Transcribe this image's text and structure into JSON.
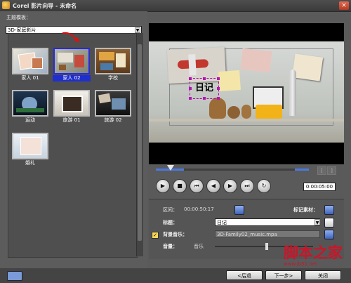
{
  "window": {
    "title": "Corel 影片向导 - 未命名"
  },
  "left_panel": {
    "theme_label": "主题模板：",
    "theme_select": "3D-家庭影片",
    "templates": [
      {
        "label": "家人 01",
        "selected": false
      },
      {
        "label": "家人 02",
        "selected": true
      },
      {
        "label": "学校",
        "selected": false
      },
      {
        "label": "运动",
        "selected": false
      },
      {
        "label": "旅游 01",
        "selected": false
      },
      {
        "label": "旅游 02",
        "selected": false
      },
      {
        "label": "婚礼",
        "selected": false
      }
    ]
  },
  "preview": {
    "overlay_text": "日记",
    "timecode": "0:00:05:00"
  },
  "transport": {
    "play": "▶",
    "stop": "■",
    "home": "⏮",
    "prev": "◀",
    "next": "▶",
    "end": "⏭",
    "repeat": "↻"
  },
  "properties": {
    "interval_label": "区间：",
    "interval_value": "00:00:50:17",
    "mark_material_label": "标记素材：",
    "title_label": "标题：",
    "title_value": "日记",
    "music_label": "背景音乐：",
    "music_value": "3D-Family02_music.mpa",
    "volume_label": "音量：",
    "volume_sub": "音乐"
  },
  "navigation": {
    "back": "<后退",
    "next": "下一步>",
    "close": "关闭"
  },
  "watermark": {
    "text": "脚本之家",
    "url": "www.jb51.net"
  },
  "colors": {
    "selection": "#1f2fcf",
    "accent": "#4a7ae0",
    "watermark": "#c8162a"
  },
  "icons": [
    "close-icon",
    "help-icon",
    "title-edit-icon",
    "music-icon",
    "mark-material-icon"
  ]
}
